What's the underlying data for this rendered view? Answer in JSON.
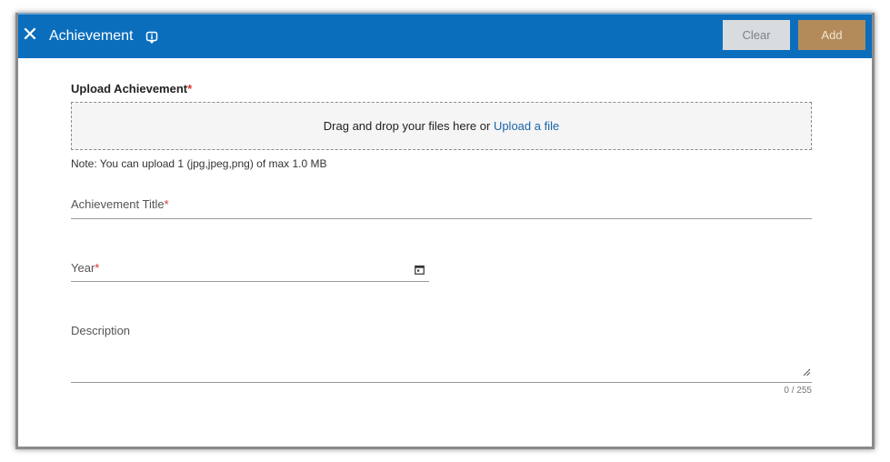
{
  "header": {
    "title": "Achievement",
    "close_icon": "close-icon",
    "info_icon": "info-icon",
    "clear_label": "Clear",
    "add_label": "Add",
    "bg_color": "#0a6ebd"
  },
  "upload": {
    "label": "Upload Achievement",
    "required_mark": "*",
    "drop_text": "Drag and drop your files here or ",
    "link_text": "Upload a file",
    "note": "Note: You can upload 1 (jpg,jpeg,png) of max 1.0 MB"
  },
  "fields": {
    "title_label": "Achievement Title",
    "title_required": "*",
    "year_label": "Year",
    "year_required": "*",
    "year_icon": "calendar-icon",
    "description_label": "Description",
    "description_counter": "0 / 255",
    "resize_icon": "resize-handle-icon"
  },
  "colors": {
    "accent": "#0a6ebd",
    "add_button": "#b38b5b",
    "clear_button": "#d9dcdf",
    "required": "#d9342b",
    "link": "#1b64a8"
  }
}
